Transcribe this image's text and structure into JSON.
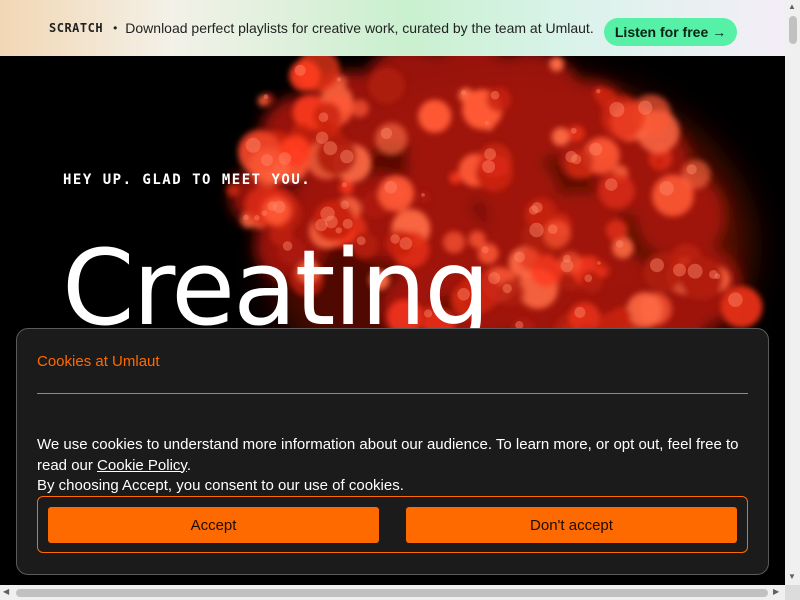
{
  "banner": {
    "brand": "SCRATCH",
    "separator": "•",
    "text": "Download perfect playlists for creative work, curated by the team at Umlaut.",
    "cta_label": "Listen for free →"
  },
  "hero": {
    "eyebrow": "HEY UP. GLAD TO MEET YOU.",
    "heading": "Creating",
    "art_color": "#ff3b1f"
  },
  "cookie": {
    "title": "Cookies at Umlaut",
    "body_before_link": "We use cookies to understand more information about our audience. To learn more, or opt out, feel free to read our ",
    "link_label": "Cookie Policy",
    "body_after_link": ".",
    "body_line2": "By choosing Accept, you consent to our use of cookies.",
    "accept_label": "Accept",
    "decline_label": "Don't accept",
    "accent_color": "#ff6a00"
  },
  "scrollbars": {
    "up_arrow": "▲",
    "down_arrow": "▼",
    "left_arrow": "◀",
    "right_arrow": "▶"
  }
}
